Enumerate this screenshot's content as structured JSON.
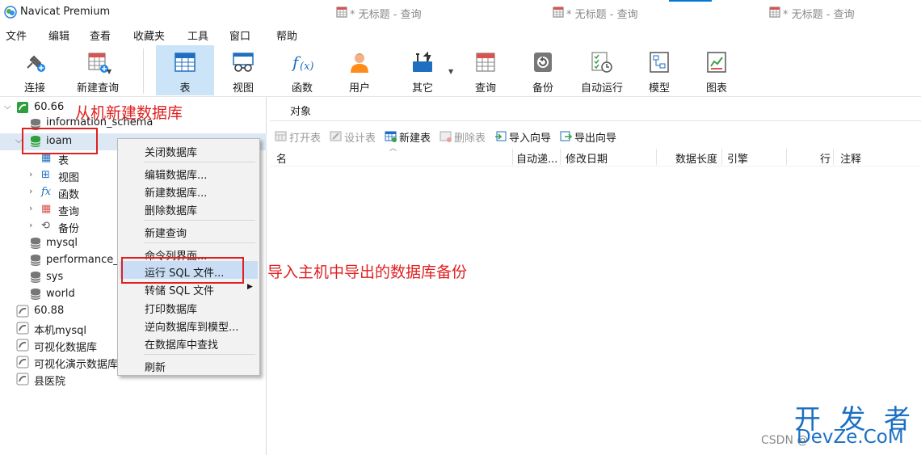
{
  "app": {
    "title": "Navicat Premium"
  },
  "menu": [
    "文件",
    "编辑",
    "查看",
    "收藏夹",
    "工具",
    "窗口",
    "帮助"
  ],
  "toolbar": [
    {
      "label": "连接",
      "icon": "plug-icon"
    },
    {
      "label": "新建查询",
      "icon": "new-query-icon"
    },
    {
      "label": "表",
      "icon": "table-icon"
    },
    {
      "label": "视图",
      "icon": "view-icon"
    },
    {
      "label": "函数",
      "icon": "function-icon"
    },
    {
      "label": "用户",
      "icon": "user-icon"
    },
    {
      "label": "其它",
      "icon": "tools-icon"
    },
    {
      "label": "查询",
      "icon": "query-icon"
    },
    {
      "label": "备份",
      "icon": "backup-icon"
    },
    {
      "label": "自动运行",
      "icon": "schedule-icon"
    },
    {
      "label": "模型",
      "icon": "model-icon"
    },
    {
      "label": "图表",
      "icon": "chart-icon"
    }
  ],
  "toolbar_active": "表",
  "tree": {
    "conn1": "60.66",
    "databases_before": [
      "information_schema"
    ],
    "ioam": "ioam",
    "ioam_children": [
      {
        "label": "表",
        "glyph": "▦"
      },
      {
        "label": "视图",
        "glyph": "⊞"
      },
      {
        "label": "函数",
        "glyph": "fx"
      },
      {
        "label": "查询",
        "glyph": "▦"
      },
      {
        "label": "备份",
        "glyph": "⟲"
      }
    ],
    "databases_after": [
      "mysql",
      "performance_s",
      "sys",
      "world"
    ],
    "connections": [
      "60.88",
      "本机mysql",
      "可视化数据库",
      "可视化演示数据库",
      "县医院"
    ]
  },
  "tabs": {
    "object": "对象",
    "query_tabs": [
      "* 无标题 - 查询",
      "* 无标题 - 查询",
      "* 无标题 - 查询"
    ]
  },
  "actions": [
    {
      "label": "打开表",
      "enabled": false
    },
    {
      "label": "设计表",
      "enabled": false
    },
    {
      "label": "新建表",
      "enabled": true
    },
    {
      "label": "删除表",
      "enabled": false
    },
    {
      "label": "导入向导",
      "enabled": true
    },
    {
      "label": "导出向导",
      "enabled": true
    }
  ],
  "columns": [
    "名",
    "自动递...",
    "修改日期",
    "数据长度",
    "引擎",
    "行",
    "注释"
  ],
  "context_menu": {
    "items": [
      "关闭数据库",
      "编辑数据库...",
      "新建数据库...",
      "删除数据库",
      "新建查询",
      "命令列界面...",
      "运行 SQL 文件...",
      "转储 SQL 文件",
      "打印数据库",
      "逆向数据库到模型...",
      "在数据库中查找",
      "刷新"
    ],
    "highlighted": "运行 SQL 文件..."
  },
  "annotations": {
    "top": "从机新建数据库",
    "middle": "导入主机中导出的数据库备份"
  },
  "watermark": {
    "big": "开 发 者",
    "csdn": "CSDN @",
    "domain": "DevZe.CoM"
  },
  "colors": {
    "accent": "#0078d7",
    "active_bg": "#cce4f7",
    "annotation": "#e02020",
    "watermark": "#1b6fc4",
    "db_green": "#2e9e3e"
  }
}
